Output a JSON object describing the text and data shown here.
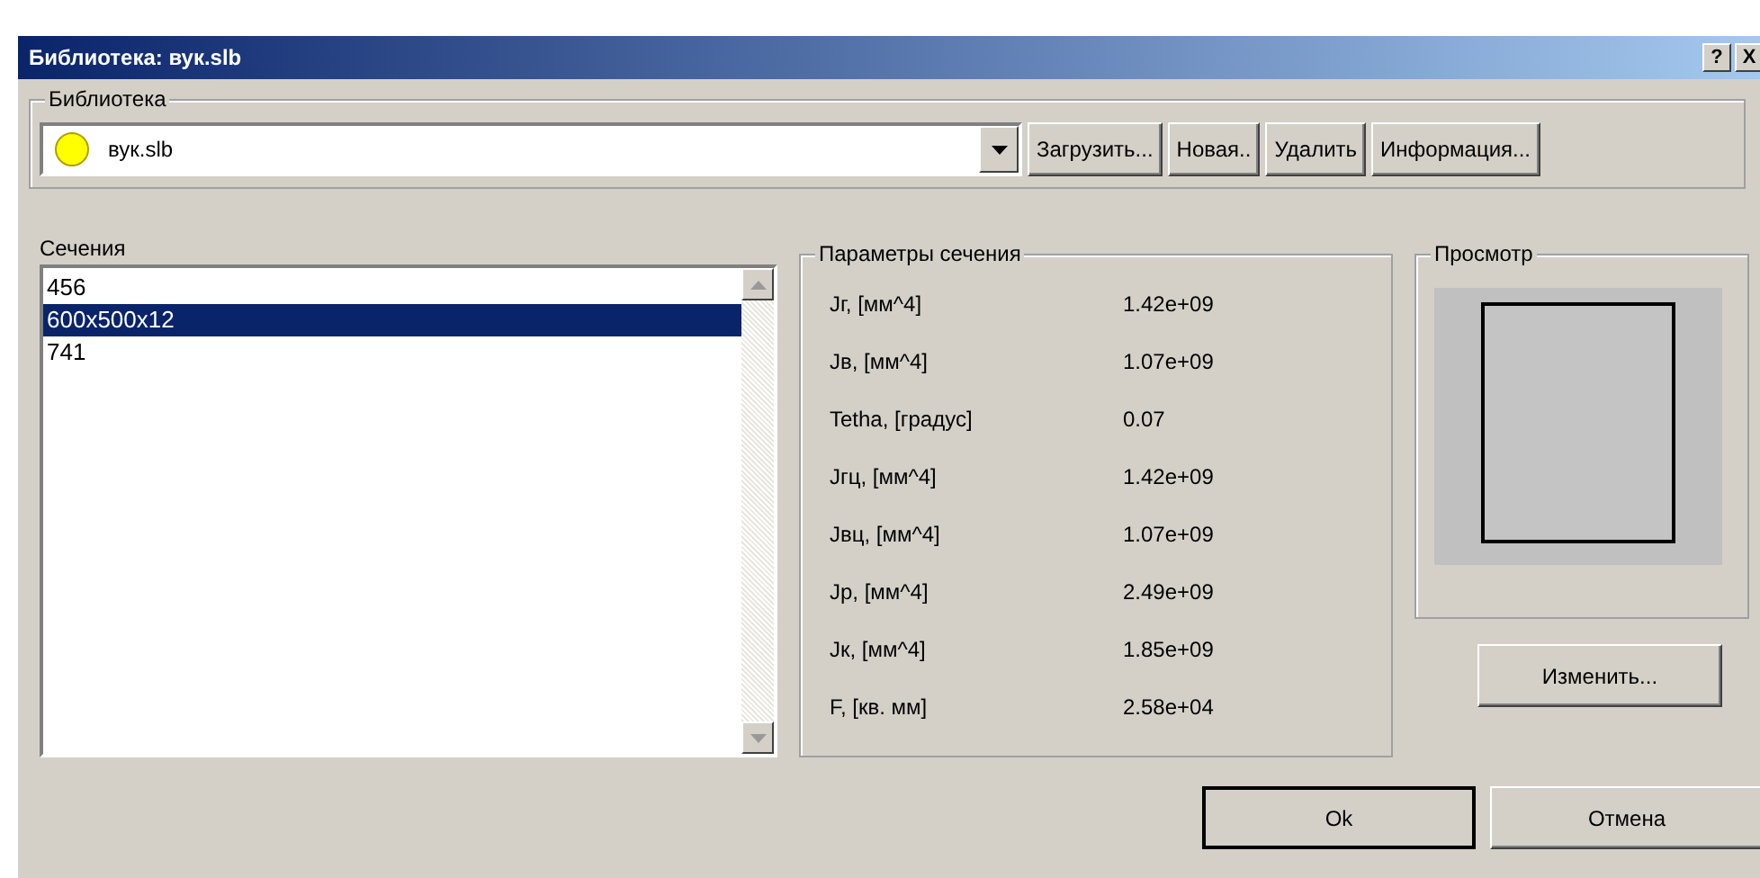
{
  "window": {
    "title": "Библиотека: вук.slb",
    "title_buttons": [
      "?",
      "X"
    ]
  },
  "library": {
    "legend": "Библиотека",
    "value": "вук.slb",
    "buttons": [
      "Загрузить...",
      "Новая..",
      "Удалить",
      "Информация..."
    ]
  },
  "sections": {
    "label": "Сечения",
    "items": [
      {
        "label": "456",
        "selected": false
      },
      {
        "label": "600x500x12",
        "selected": true
      },
      {
        "label": "741",
        "selected": false
      }
    ]
  },
  "parameters": {
    "legend": "Параметры сечения",
    "rows": [
      {
        "name": "Jг, [мм^4]",
        "value": "1.42e+09"
      },
      {
        "name": "Jв, [мм^4]",
        "value": "1.07e+09"
      },
      {
        "name": "Tetha, [градус]",
        "value": "0.07"
      },
      {
        "name": "Jгц, [мм^4]",
        "value": "1.42e+09"
      },
      {
        "name": "Jвц, [мм^4]",
        "value": "1.07e+09"
      },
      {
        "name": "Jр, [мм^4]",
        "value": "2.49e+09"
      },
      {
        "name": "Jк, [мм^4]",
        "value": "1.85e+09"
      },
      {
        "name": "F, [кв. мм]",
        "value": "2.58e+04"
      }
    ]
  },
  "preview": {
    "legend": "Просмотр",
    "button": "Изменить..."
  },
  "buttons": [
    {
      "label": "Ok",
      "default": true
    },
    {
      "label": "Отмена",
      "default": false
    }
  ]
}
